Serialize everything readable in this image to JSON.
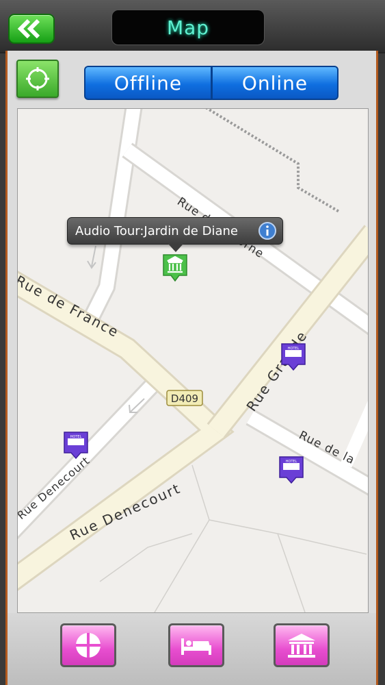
{
  "header": {
    "title": "Map",
    "back_icon": "double-chevron-left-icon"
  },
  "toolbar": {
    "locate_icon": "crosshair-icon",
    "segments": [
      "Offline",
      "Online"
    ]
  },
  "map": {
    "streets": [
      "Rue de France",
      "Rue Denecourt",
      "Rue Denecourt",
      "Rue Grande",
      "Rue de la",
      "Rue de l'Écorne",
      "D409"
    ],
    "callout": {
      "title": "Audio Tour:Jardin de Diane"
    },
    "markers": [
      {
        "type": "museum",
        "color": "#4cc04a"
      },
      {
        "type": "hotel",
        "color": "#6a3fd6"
      },
      {
        "type": "hotel",
        "color": "#6a3fd6"
      },
      {
        "type": "hotel",
        "color": "#6a3fd6"
      }
    ]
  },
  "footer": {
    "buttons": [
      "compass-icon",
      "bed-icon",
      "museum-icon"
    ]
  },
  "colors": {
    "accent": "#b35a1e",
    "segment_blue": "#0f6fe0",
    "footer_pink": "#e84fd0",
    "marker_green": "#4cc04a"
  }
}
